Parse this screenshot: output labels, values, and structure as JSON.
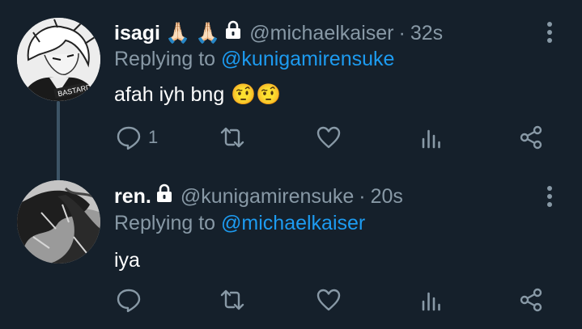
{
  "tweets": [
    {
      "name": "isagi",
      "name_emojis": [
        "🙏🏻",
        "🙏🏻"
      ],
      "handle": "@michaelkaiser",
      "separator": "·",
      "time": "32s",
      "replying_prefix": "Replying to",
      "replying_to": "@kunigamirensuke",
      "text": "afah iyh bng",
      "text_emojis": [
        "🤨",
        "🤨"
      ],
      "reply_count": "1",
      "avatar_text": "BASTARD"
    },
    {
      "name": "ren.",
      "handle": "@kunigamirensuke",
      "separator": "·",
      "time": "20s",
      "replying_prefix": "Replying to",
      "replying_to": "@michaelkaiser",
      "text": "iya",
      "reply_count": ""
    }
  ],
  "icons": {
    "lock": "lock-icon",
    "more": "more-vertical-icon",
    "reply": "comment-icon",
    "retweet": "retweet-icon",
    "like": "heart-icon",
    "stats": "bar-chart-icon",
    "share": "share-icon"
  },
  "colors": {
    "background": "#15202b",
    "text": "#ffffff",
    "muted": "#8899a6",
    "link": "#1d9bf0",
    "thread_line": "#3d5466"
  }
}
